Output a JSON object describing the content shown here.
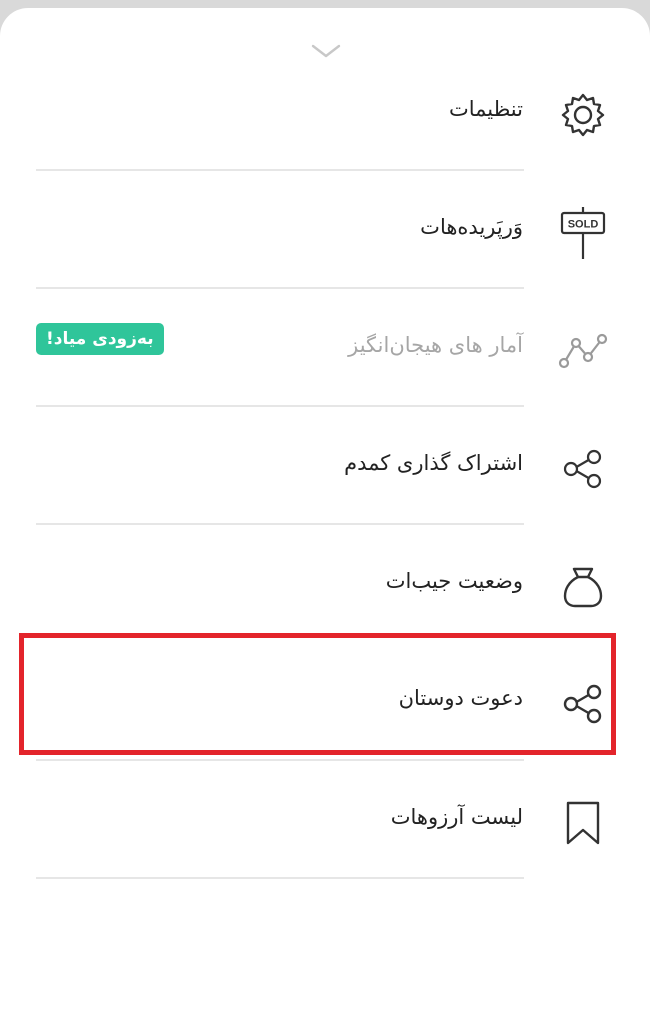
{
  "menu": {
    "items": [
      {
        "label": "تنظیمات",
        "icon": "gear-icon"
      },
      {
        "label": "وَرپَریده‌هات",
        "icon": "sold-sign-icon",
        "icon_text": "SOLD"
      },
      {
        "label": "آمار های هیجان‌انگیز",
        "icon": "line-chart-icon",
        "badge": "به‌زودی میاد!",
        "disabled": true
      },
      {
        "label": "اشتراک گذاری کمدم",
        "icon": "share-icon"
      },
      {
        "label": "وضعیت جیب‌ات",
        "icon": "money-bag-icon"
      },
      {
        "label": "دعوت دوستان",
        "icon": "share-icon",
        "highlighted": true
      },
      {
        "label": "لیست آرزوهات",
        "icon": "bookmark-icon"
      }
    ]
  },
  "colors": {
    "badge_bg": "#2fc59a",
    "highlight_border": "#e3242b",
    "text": "#222222",
    "disabled_text": "#a6a6a6",
    "icon": "#333333"
  }
}
